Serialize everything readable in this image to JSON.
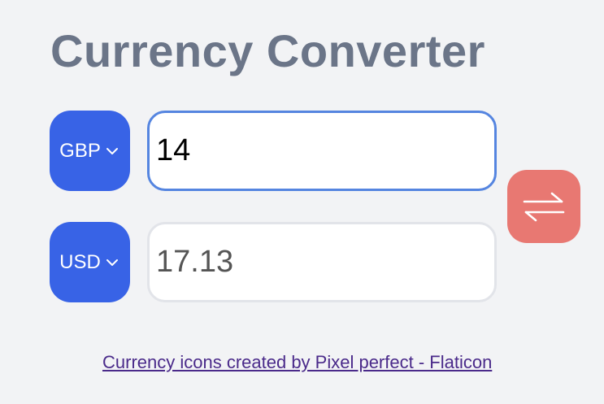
{
  "app": {
    "title": "Currency Converter"
  },
  "converter": {
    "from": {
      "currency": "GBP",
      "amount": "14"
    },
    "to": {
      "currency": "USD",
      "amount": "17.13"
    },
    "swap_icon": "swap-arrows-icon"
  },
  "footer": {
    "credit_link": "Currency icons created by Pixel perfect - Flaticon"
  },
  "colors": {
    "select_bg": "#3863e6",
    "swap_bg": "#e87872",
    "title": "#6b7588",
    "active_border": "#5585e0",
    "page_bg": "#f2f3f5"
  }
}
